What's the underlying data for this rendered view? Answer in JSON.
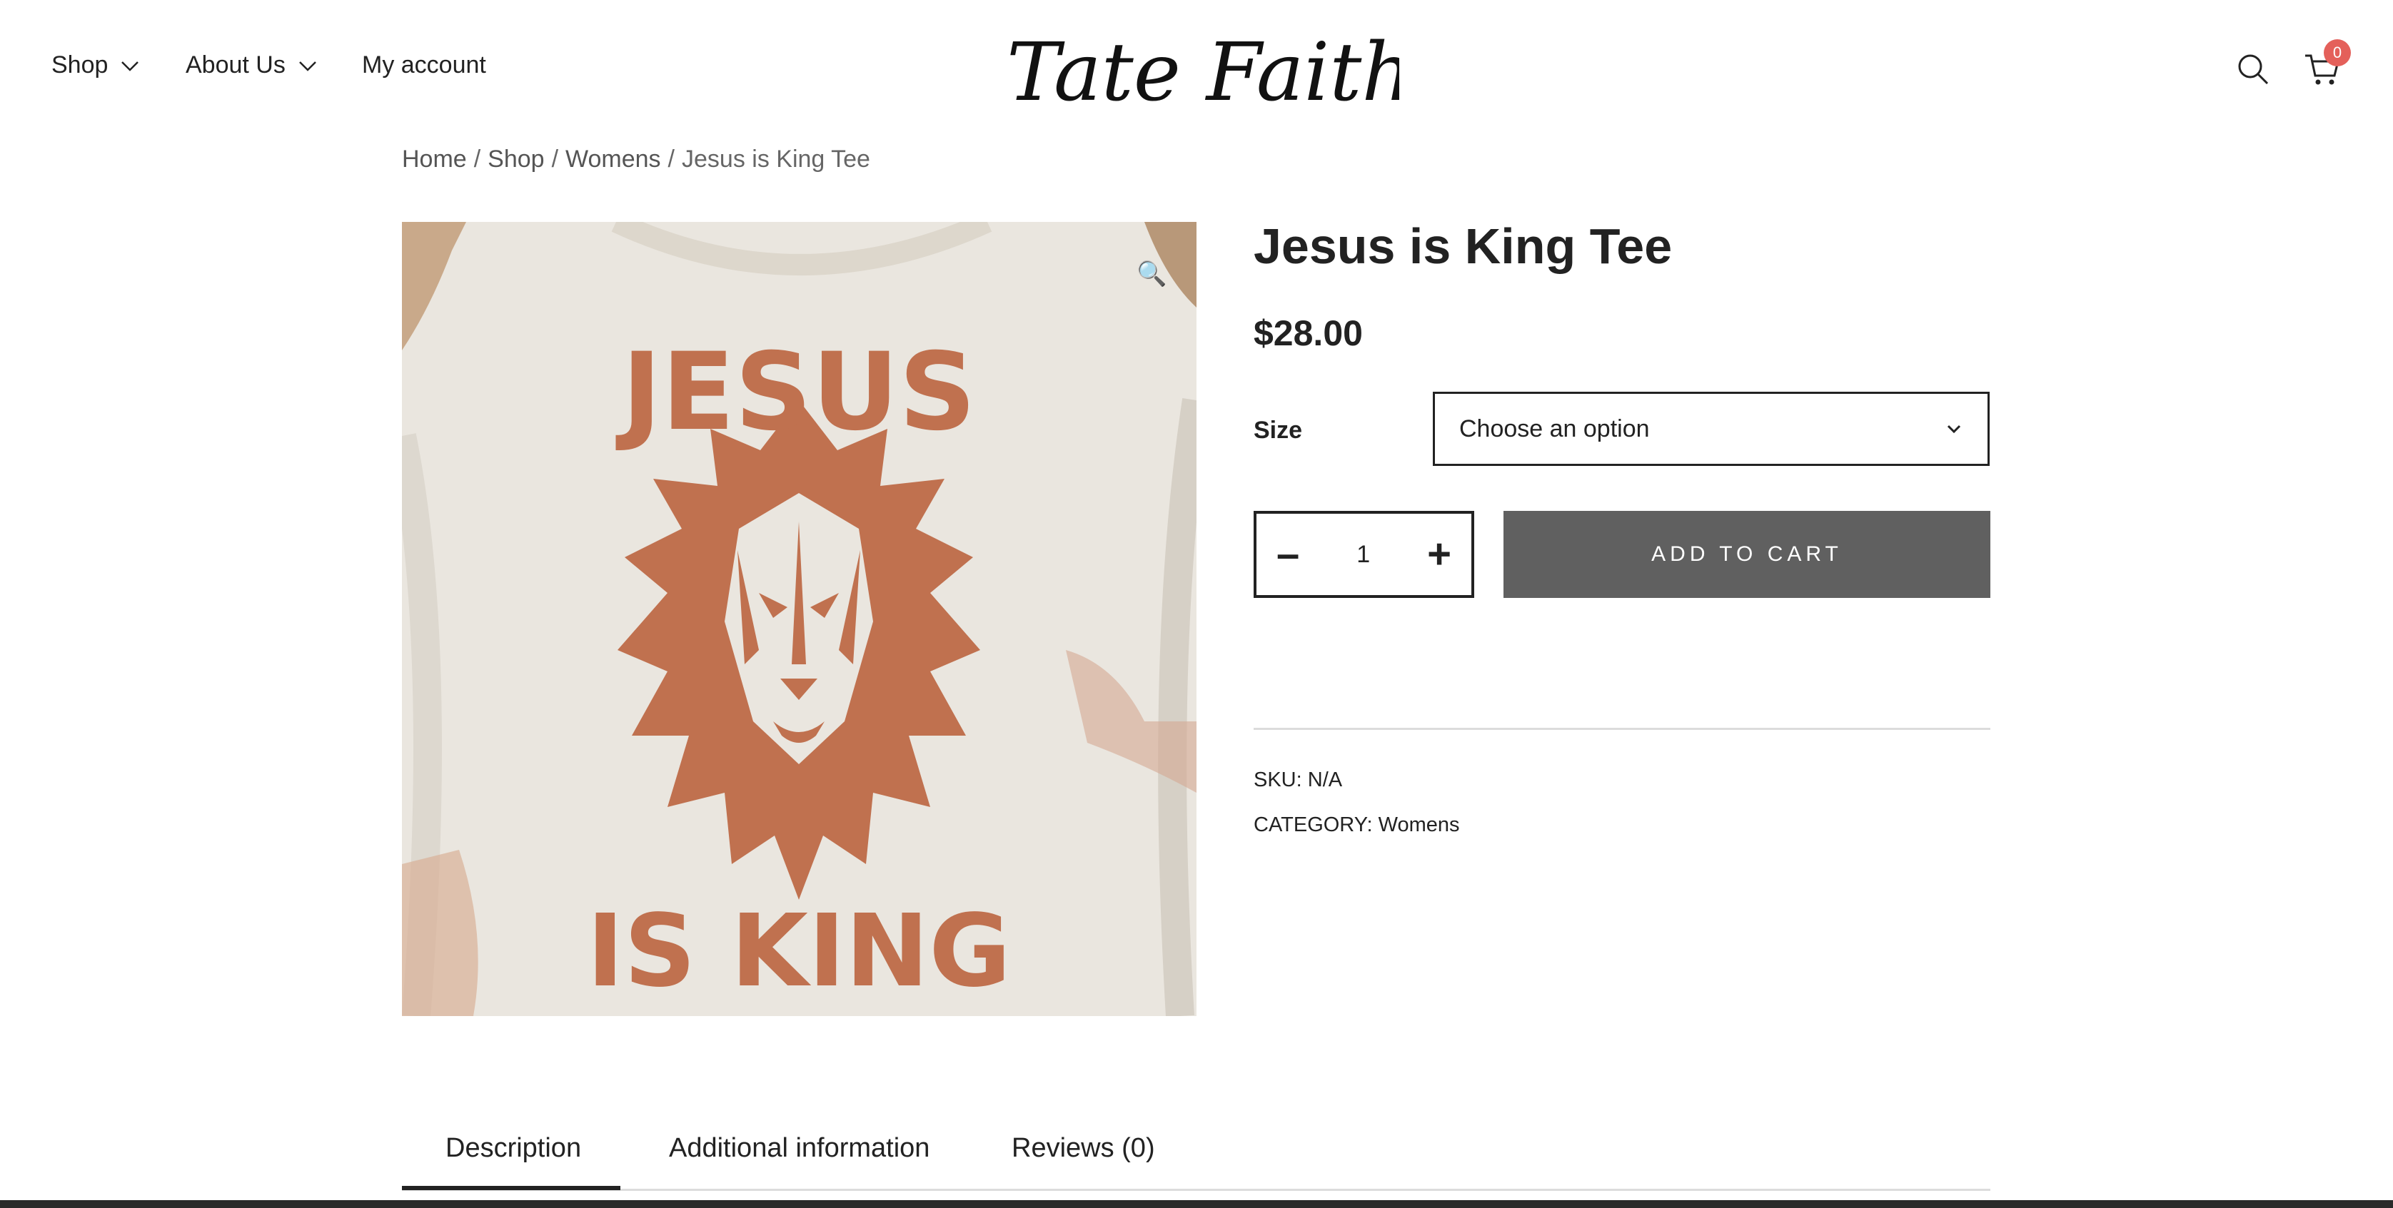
{
  "header": {
    "nav": [
      {
        "label": "Shop",
        "has_dropdown": true
      },
      {
        "label": "About Us",
        "has_dropdown": true
      },
      {
        "label": "My account",
        "has_dropdown": false
      }
    ],
    "logo_text": "Tate Faith & Co",
    "cart_count": "0",
    "icons": [
      "search-icon",
      "cart-icon"
    ]
  },
  "breadcrumb": {
    "home": "Home",
    "sep": "/",
    "shop": "Shop",
    "category": "Womens",
    "current": "Jesus is King Tee"
  },
  "product": {
    "image_text_top": "JESUS",
    "image_text_bottom": "IS KING",
    "zoom_icon": "🔍",
    "title": "Jesus is King Tee",
    "price": "$28.00",
    "size_label": "Size",
    "size_select_value": "Choose an option",
    "quantity": "1",
    "minus": "–",
    "plus": "+",
    "add_to_cart": "ADD TO CART",
    "sku_label": "SKU:",
    "sku_value": "N/A",
    "category_label": "CATEGORY:",
    "category_value": "Womens"
  },
  "tabs": [
    {
      "label": "Description",
      "active": true
    },
    {
      "label": "Additional information",
      "active": false
    },
    {
      "label": "Reviews (0)",
      "active": false
    }
  ],
  "colors": {
    "accent_button": "#606060",
    "badge": "#e4605a",
    "print_color": "#c0714f"
  }
}
